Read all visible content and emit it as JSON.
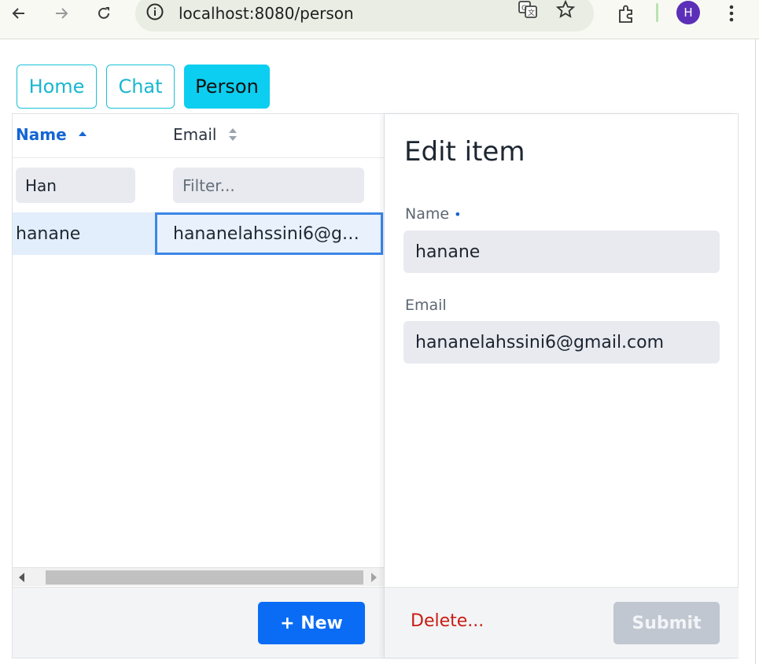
{
  "browser": {
    "url": "localhost:8080/person",
    "profile_initial": "H",
    "icons": [
      "back-icon",
      "forward-icon",
      "reload-icon",
      "info-icon",
      "translate-icon",
      "bookmark-star-icon",
      "extensions-icon",
      "menu-dots-icon"
    ]
  },
  "nav": {
    "items": [
      {
        "label": "Home",
        "active": false
      },
      {
        "label": "Chat",
        "active": false
      },
      {
        "label": "Person",
        "active": true
      }
    ]
  },
  "grid": {
    "columns": [
      {
        "label": "Name",
        "sort": "ascending"
      },
      {
        "label": "Email",
        "sort": "none"
      }
    ],
    "filters": {
      "name_value": "Han",
      "email_placeholder": "Filter..."
    },
    "rows": [
      {
        "name": "hanane",
        "email": "hananelahssini6@g…",
        "selected": true
      }
    ],
    "new_button_label": "+ New"
  },
  "edit": {
    "title": "Edit item",
    "fields": [
      {
        "label": "Name",
        "required": true,
        "value": "hanane"
      },
      {
        "label": "Email",
        "required": false,
        "value": "hananelahssini6@gmail.com"
      }
    ],
    "delete_label": "Delete...",
    "submit_label": "Submit"
  },
  "colors": {
    "accent": "#0a6cf5",
    "nav_active": "#0ccef0",
    "nav_outline": "#18c2d8",
    "selected_row": "#e3eefc",
    "danger": "#c81d12"
  }
}
